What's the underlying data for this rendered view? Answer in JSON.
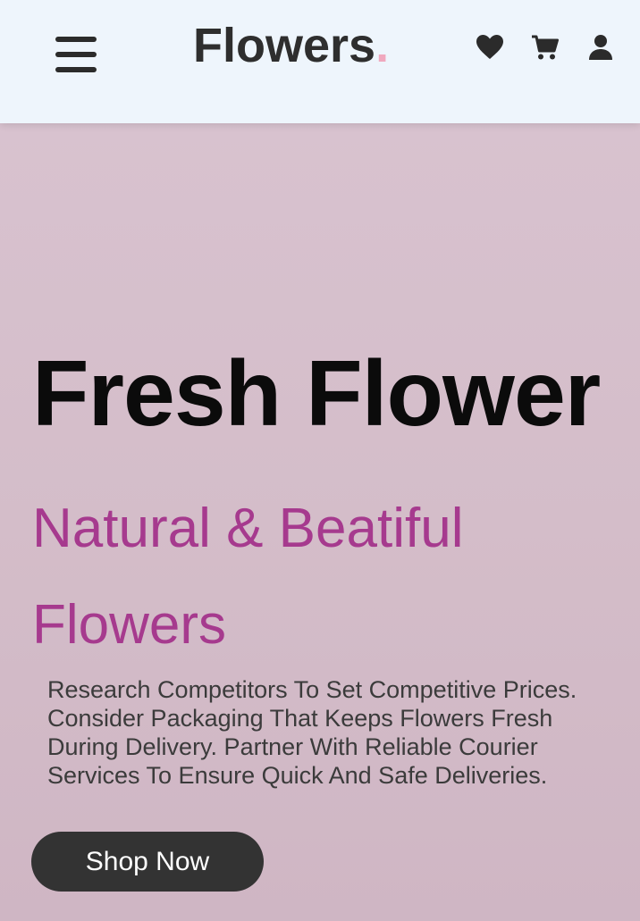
{
  "header": {
    "logo_text": "Flowers",
    "logo_dot": ".",
    "icons": [
      "heart-icon",
      "cart-icon",
      "user-icon"
    ],
    "menu_icon": "hamburger-menu-icon"
  },
  "hero": {
    "title": "Fresh Flower",
    "subtitle_line1": "Natural & Beatiful",
    "subtitle_line2": "Flowers",
    "description": "Research Competitors To Set Competitive Prices. Consider Packaging That Keeps Flowers Fresh During Delivery. Partner With Reliable Courier Services To Ensure Quick And Safe Deliveries.",
    "button_label": "Shop Now"
  },
  "colors": {
    "header_bg": "#eef5fc",
    "hero_bg": "#d5bfcc",
    "accent": "#a63a8e",
    "logo_dot": "#f0a8be",
    "button_bg": "#333333"
  }
}
